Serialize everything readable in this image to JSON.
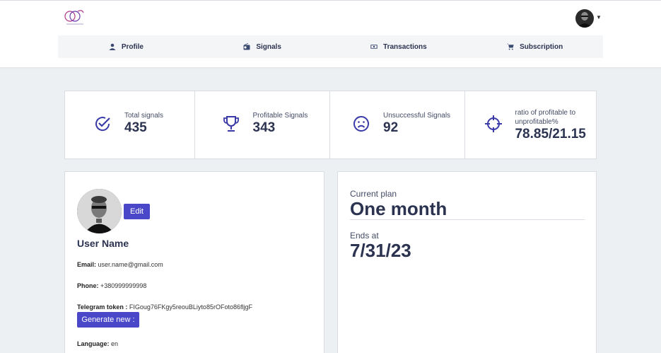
{
  "header": {
    "nav": [
      {
        "label": "Profile",
        "icon": "person-icon"
      },
      {
        "label": "Signals",
        "icon": "radio-icon"
      },
      {
        "label": "Transactions",
        "icon": "cash-icon"
      },
      {
        "label": "Subscription",
        "icon": "cart-icon"
      }
    ]
  },
  "stats": [
    {
      "label": "Total signals",
      "value": "435",
      "icon": "check-circle-icon"
    },
    {
      "label": "Profitable Signals",
      "value": "343",
      "icon": "trophy-icon"
    },
    {
      "label": "Unsuccessful Signals",
      "value": "92",
      "icon": "sad-face-icon"
    },
    {
      "label": "ratio of profitable to unprofitable%",
      "value": "78.85/21.15",
      "icon": "crosshair-icon"
    }
  ],
  "profile": {
    "edit_label": "Edit",
    "name": "User Name",
    "email_label": "Email:",
    "email": "user.name@gmail.com",
    "phone_label": "Phone:",
    "phone": "+380999999998",
    "telegram_label": "Telegram token :",
    "telegram_token": "FIGoug76FKgy5reouBLiyto85rOFoto86fljgF",
    "generate_label": "Generate new :",
    "language_label": "Language:",
    "language": "en"
  },
  "plan": {
    "current_label": "Current plan",
    "current_value": "One month",
    "ends_label": "Ends at",
    "ends_value": "7/31/23"
  },
  "colors": {
    "accent": "#4a47c8",
    "icon": "#3a3aa8",
    "text": "#2b3350",
    "background": "#edf0f3"
  }
}
